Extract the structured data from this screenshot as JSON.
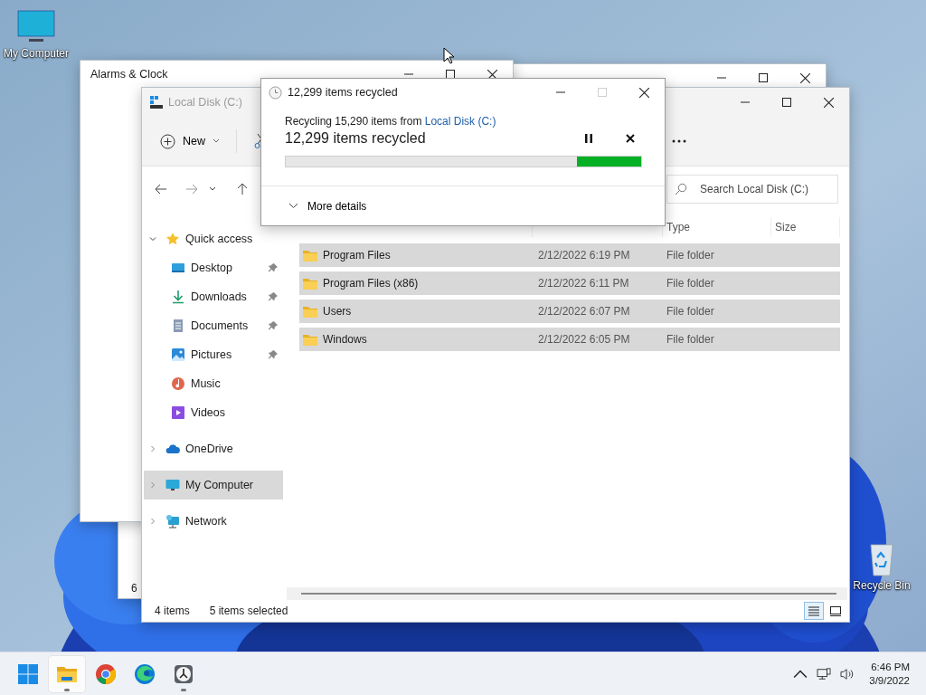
{
  "desktop_icons": [
    {
      "label": "My Computer",
      "kind": "computer"
    },
    {
      "label": "Recycle Bin",
      "kind": "recycle"
    }
  ],
  "back_window": {
    "status_text": "6"
  },
  "alarms_window": {
    "title": "Alarms & Clock"
  },
  "explorer": {
    "title": "Local Disk (C:)",
    "active": false,
    "toolbar": {
      "new_label": "New"
    },
    "search": {
      "placeholder": "Search Local Disk (C:)"
    },
    "columns": [
      {
        "label": "Type"
      },
      {
        "label": "Size"
      }
    ],
    "rows": [
      {
        "name": "Program Files",
        "date": "2/12/2022 6:19 PM",
        "type": "File folder",
        "selected": true
      },
      {
        "name": "Program Files (x86)",
        "date": "2/12/2022 6:11 PM",
        "type": "File folder",
        "selected": true
      },
      {
        "name": "Users",
        "date": "2/12/2022 6:07 PM",
        "type": "File folder",
        "selected": true
      },
      {
        "name": "Windows",
        "date": "2/12/2022 6:05 PM",
        "type": "File folder",
        "selected": true
      }
    ],
    "sidebar": [
      {
        "label": "Quick access",
        "kind": "star",
        "expanded": true,
        "selected": false,
        "children": [
          {
            "label": "Desktop",
            "kind": "desktop",
            "pinned": true,
            "selected": false
          },
          {
            "label": "Downloads",
            "kind": "download",
            "pinned": true,
            "selected": false
          },
          {
            "label": "Documents",
            "kind": "document",
            "pinned": true,
            "selected": false
          },
          {
            "label": "Pictures",
            "kind": "pictures",
            "pinned": true,
            "selected": false
          },
          {
            "label": "Music",
            "kind": "music",
            "pinned": false,
            "selected": false
          },
          {
            "label": "Videos",
            "kind": "videos",
            "pinned": false,
            "selected": false
          }
        ]
      },
      {
        "label": "OneDrive",
        "kind": "cloud",
        "expanded": false,
        "selected": false
      },
      {
        "label": "My Computer",
        "kind": "computer",
        "expanded": false,
        "selected": true
      },
      {
        "label": "Network",
        "kind": "network",
        "expanded": false,
        "selected": false
      }
    ],
    "status": {
      "count": "4 items",
      "selection": "5 items selected"
    },
    "views": [
      {
        "kind": "details",
        "selected": true
      },
      {
        "kind": "tiles",
        "selected": false
      }
    ]
  },
  "dialog": {
    "title": "12,299 items recycled",
    "maximize_disabled": true,
    "line": "Recycling 15,290 items from ",
    "source_link": "Local Disk (C:)",
    "headline": "12,299 items recycled",
    "progress": {
      "level": 0.18
    },
    "details_label": "More details"
  },
  "taskbar": {
    "apps": [
      {
        "kind": "start",
        "active": false,
        "running": false
      },
      {
        "kind": "explorer",
        "active": true,
        "running": true
      },
      {
        "kind": "chrome",
        "active": false,
        "running": false
      },
      {
        "kind": "edge",
        "active": false,
        "running": false
      },
      {
        "kind": "clock",
        "active": false,
        "running": true
      }
    ],
    "time": "6:46 PM",
    "date": "3/9/2022"
  }
}
